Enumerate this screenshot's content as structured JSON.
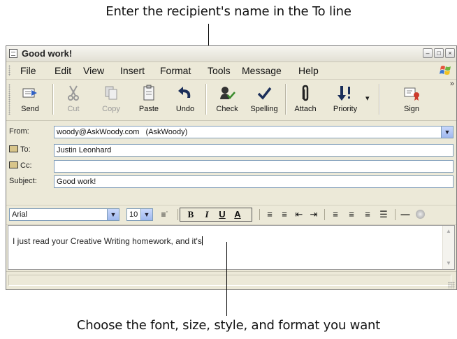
{
  "callouts": {
    "top": "Enter the recipient's name in the To line",
    "bottom": "Choose the font, size, style, and format you want"
  },
  "window": {
    "title": "Good work!",
    "controls": [
      "minimize",
      "maximize",
      "close"
    ]
  },
  "menu": [
    "File",
    "Edit",
    "View",
    "Insert",
    "Format",
    "Tools",
    "Message",
    "Help"
  ],
  "toolbar": {
    "buttons": [
      {
        "label": "Send",
        "icon": "send-icon",
        "enabled": true
      },
      {
        "label": "Cut",
        "icon": "scissors-icon",
        "enabled": false
      },
      {
        "label": "Copy",
        "icon": "copy-icon",
        "enabled": false
      },
      {
        "label": "Paste",
        "icon": "clipboard-icon",
        "enabled": true
      },
      {
        "label": "Undo",
        "icon": "undo-icon",
        "enabled": true
      },
      {
        "label": "Check",
        "icon": "check-names-icon",
        "enabled": true
      },
      {
        "label": "Spelling",
        "icon": "checkmark-icon",
        "enabled": true
      },
      {
        "label": "Attach",
        "icon": "paperclip-icon",
        "enabled": true
      },
      {
        "label": "Priority",
        "icon": "priority-icon",
        "enabled": true
      },
      {
        "label": "Sign",
        "icon": "sign-icon",
        "enabled": true
      }
    ],
    "more_glyph": "»"
  },
  "headers": {
    "from_label": "From:",
    "from_value": "woody@AskWoody.com   (AskWoody)",
    "to_label": "To:",
    "to_value": "Justin Leonhard",
    "cc_label": "Cc:",
    "cc_value": "",
    "subject_label": "Subject:",
    "subject_value": "Good work!"
  },
  "format": {
    "font": "Arial",
    "size": "10",
    "bold": "B",
    "italic": "I",
    "underline": "U",
    "font_color": "A"
  },
  "body": {
    "text": "I just read your Creative Writing homework, and it's"
  },
  "colors": {
    "window_bg": "#ece9d8",
    "field_border": "#7f9db9",
    "accent_blue": "#1f4fb5"
  }
}
